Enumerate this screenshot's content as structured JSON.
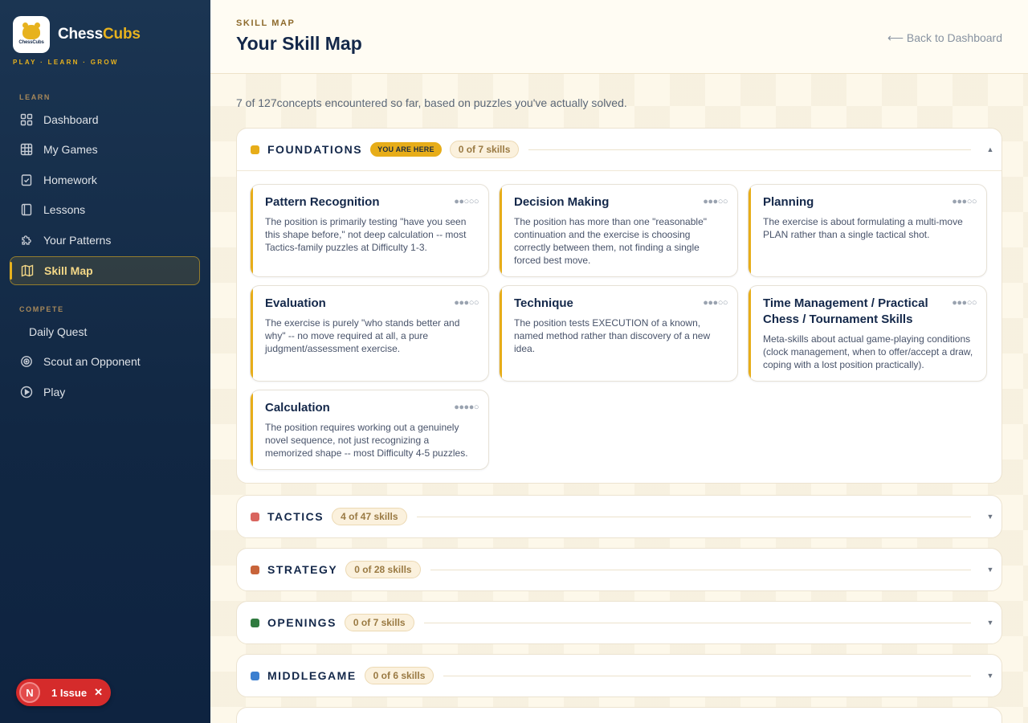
{
  "brand": {
    "name_a": "Chess",
    "name_b": "Cubs",
    "logo_text": "ChessCubs",
    "tagline": "PLAY · LEARN · GROW"
  },
  "sidebar": {
    "learn_label": "LEARN",
    "learn_items": [
      {
        "label": "Dashboard",
        "icon": "dashboard-icon"
      },
      {
        "label": "My Games",
        "icon": "grid-icon"
      },
      {
        "label": "Homework",
        "icon": "clipboard-check-icon"
      },
      {
        "label": "Lessons",
        "icon": "book-icon"
      },
      {
        "label": "Your Patterns",
        "icon": "puzzle-icon"
      },
      {
        "label": "Skill Map",
        "icon": "map-icon",
        "active": true
      }
    ],
    "compete_label": "COMPETE",
    "compete_items": [
      {
        "label": "Daily Quest"
      },
      {
        "label": "Scout an Opponent",
        "icon": "target-icon"
      },
      {
        "label": "Play",
        "icon": "play-icon"
      }
    ]
  },
  "issue": {
    "avatar": "N",
    "label": "1 Issue",
    "close": "✕"
  },
  "header": {
    "eyebrow": "SKILL MAP",
    "title": "Your Skill Map",
    "back": "⟵ Back to Dashboard"
  },
  "subtitle": "7 of 127concepts encountered so far, based on puzzles you've actually solved.",
  "categories": [
    {
      "name": "FOUNDATIONS",
      "color": "#e7ad19",
      "badge": "YOU ARE HERE",
      "count": "0 of 7 skills",
      "expanded": true,
      "chevron": "▲",
      "skills": [
        {
          "title": "Pattern Recognition",
          "pips": "●●○○○",
          "desc": "The position is primarily testing \"have you seen this shape before,\" not deep calculation -- most Tactics-family puzzles at Difficulty 1-3."
        },
        {
          "title": "Decision Making",
          "pips": "●●●○○",
          "desc": "The position has more than one \"reasonable\" continuation and the exercise is choosing correctly between them, not finding a single forced best move."
        },
        {
          "title": "Planning",
          "pips": "●●●○○",
          "desc": "The exercise is about formulating a multi-move PLAN rather than a single tactical shot."
        },
        {
          "title": "Evaluation",
          "pips": "●●●○○",
          "desc": "The exercise is purely \"who stands better and why\" -- no move required at all, a pure judgment/assessment exercise."
        },
        {
          "title": "Technique",
          "pips": "●●●○○",
          "desc": "The position tests EXECUTION of a known, named method rather than discovery of a new idea."
        },
        {
          "title": "Time Management / Practical Chess / Tournament Skills",
          "pips": "●●●○○",
          "desc": "Meta-skills about actual game-playing conditions (clock management, when to offer/accept a draw, coping with a lost position practically)."
        },
        {
          "title": "Calculation",
          "pips": "●●●●○",
          "desc": "The position requires working out a genuinely novel sequence, not just recognizing a memorized shape -- most Difficulty 4-5 puzzles."
        }
      ]
    },
    {
      "name": "TACTICS",
      "color": "#d9655f",
      "count": "4 of 47 skills",
      "chevron": "▼"
    },
    {
      "name": "STRATEGY",
      "color": "#c8643a",
      "count": "0 of 28 skills",
      "chevron": "▼"
    },
    {
      "name": "OPENINGS",
      "color": "#2f7a3f",
      "count": "0 of 7 skills",
      "chevron": "▼"
    },
    {
      "name": "MIDDLEGAME",
      "color": "#3b7fd0",
      "count": "0 of 6 skills",
      "chevron": "▼"
    }
  ]
}
